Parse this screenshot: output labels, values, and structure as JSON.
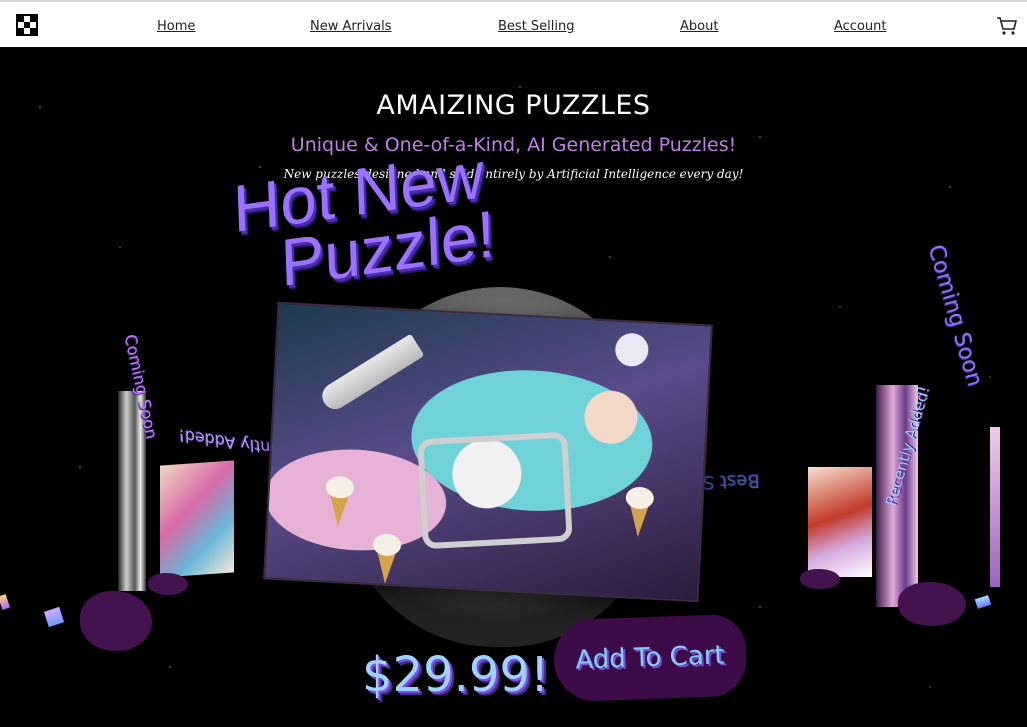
{
  "nav": {
    "items": [
      {
        "label": "Home"
      },
      {
        "label": "New Arrivals"
      },
      {
        "label": "Best Selling"
      },
      {
        "label": "About"
      },
      {
        "label": "Account"
      }
    ],
    "logo_icon": "logo-icon",
    "cart_icon": "cart-icon"
  },
  "hero": {
    "title": "AMAIZING PUZZLES",
    "subtitle": "Unique & One-of-a-Kind, AI Generated Puzzles!",
    "tagline": "New puzzles designed and sold entirely by Artificial Intelligence every day!",
    "banner_line1": "Hot New",
    "banner_line2": "Puzzle!",
    "price": "$29.99!",
    "add_to_cart": "Add To Cart",
    "side_labels": {
      "recently_added": "Recently Added!",
      "best_selling": "Best Se",
      "coming_soon": "Coming Soon"
    }
  },
  "colors": {
    "background": "#000000",
    "accent_purple": "#c07ee6",
    "button_bg": "#3d0b48",
    "button_text": "#7fd0ff"
  }
}
